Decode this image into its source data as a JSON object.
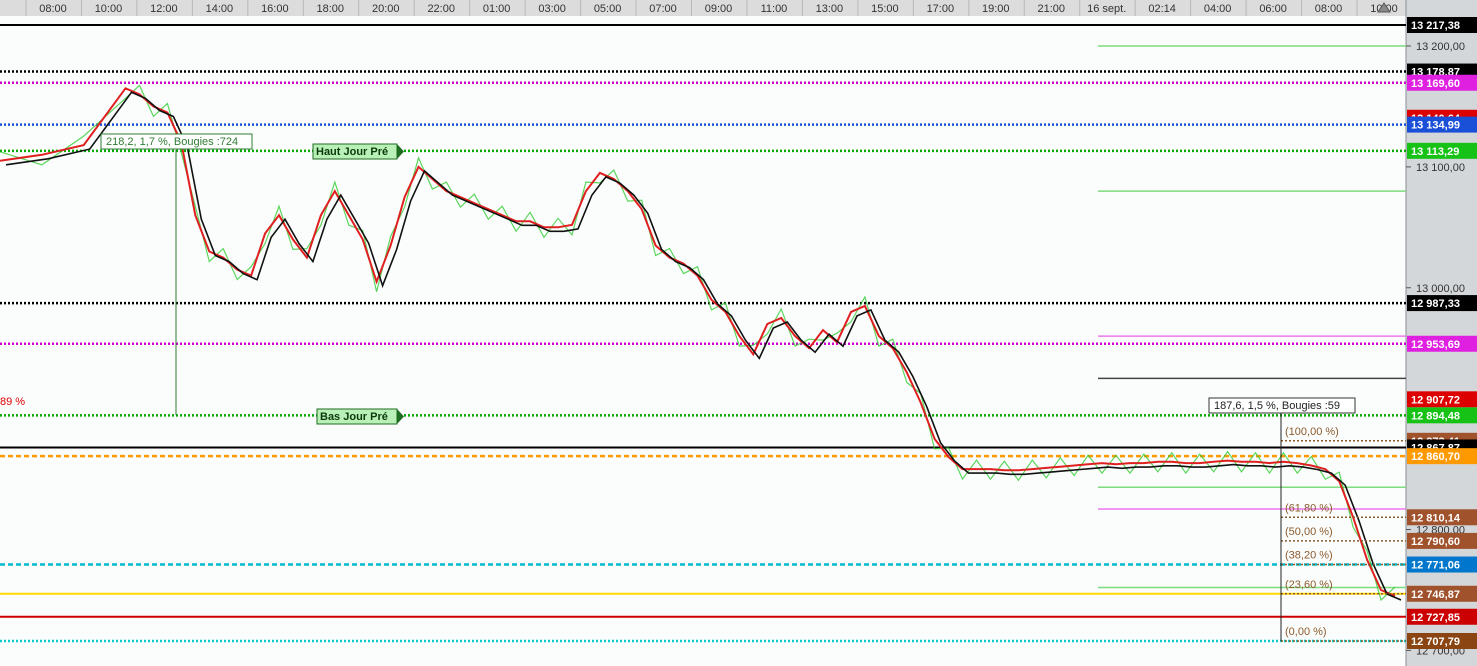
{
  "chart_data": {
    "type": "line",
    "title": "",
    "time_axis": {
      "labels": [
        "08:00",
        "10:00",
        "12:00",
        "14:00",
        "16:00",
        "18:00",
        "20:00",
        "22:00",
        "01:00",
        "03:00",
        "05:00",
        "07:00",
        "09:00",
        "11:00",
        "13:00",
        "15:00",
        "17:00",
        "19:00",
        "21:00",
        "16 sept.",
        "02:14",
        "04:00",
        "06:00",
        "08:00",
        "10:00"
      ]
    },
    "price_axis": {
      "ticks": [
        "13 200,00",
        "13 100,00",
        "13 000,00",
        "12 800,00",
        "12 700,00"
      ],
      "tick_values": [
        13200,
        13100,
        13000,
        12800,
        12700
      ],
      "range": [
        12695,
        13225
      ]
    },
    "series": [
      {
        "name": "",
        "color": "#111111",
        "x": [
          0,
          3,
          6,
          9,
          10,
          11,
          12,
          13,
          14,
          15,
          16,
          17,
          18,
          19,
          20,
          21,
          22,
          23,
          24,
          25,
          26,
          27,
          28,
          29,
          30,
          31,
          32,
          33,
          34,
          35,
          36,
          37,
          38,
          39,
          40,
          41,
          42,
          43,
          44,
          45,
          46,
          47,
          48,
          49,
          50,
          51,
          52,
          53,
          54,
          55,
          56,
          57,
          58,
          59,
          60,
          61,
          62,
          63,
          64,
          65,
          66,
          67,
          68,
          69,
          70,
          71,
          72,
          73,
          74,
          75,
          76,
          77,
          78,
          79,
          80,
          81,
          82,
          83,
          84,
          85,
          86,
          87,
          88,
          89,
          90,
          91,
          92,
          93,
          94,
          95,
          96,
          97,
          98,
          99,
          100
        ],
        "y": [
          13105,
          13110,
          13118,
          13165,
          13160,
          13150,
          13145,
          13120,
          13060,
          13030,
          13025,
          13015,
          13010,
          13045,
          13060,
          13040,
          13025,
          13060,
          13080,
          13060,
          13040,
          13005,
          13035,
          13075,
          13100,
          13090,
          13080,
          13075,
          13070,
          13065,
          13060,
          13055,
          13055,
          13050,
          13050,
          13052,
          13080,
          13095,
          13090,
          13080,
          13065,
          13035,
          13025,
          13020,
          13010,
          12990,
          12980,
          12960,
          12945,
          12970,
          12975,
          12960,
          12950,
          12965,
          12955,
          12980,
          12985,
          12960,
          12950,
          12930,
          12905,
          12875,
          12860,
          12850,
          12850,
          12850,
          12849,
          12849,
          12850,
          12851,
          12852,
          12853,
          12854,
          12855,
          12854,
          12855,
          12855,
          12856,
          12856,
          12855,
          12855,
          12856,
          12857,
          12856,
          12856,
          12855,
          12856,
          12855,
          12853,
          12850,
          12840,
          12810,
          12775,
          12750,
          12745
        ]
      }
    ],
    "levels": [
      {
        "value": 13217.38,
        "label": "13 217,38",
        "color": "#000000",
        "badge_bg": "#000000",
        "badge_fg": "#ffffff",
        "style": "solid"
      },
      {
        "value": 13178.87,
        "label": "13 178,87",
        "color": "#000000",
        "badge_bg": "#000000",
        "badge_fg": "#ffffff",
        "style": "dotted"
      },
      {
        "value": 13169.6,
        "label": "13 169,60",
        "color": "#cc00cc",
        "badge_bg": "#e020e0",
        "badge_fg": "#ffffff",
        "style": "dotted"
      },
      {
        "value": 13140.64,
        "label": "13 140,64",
        "color": "#dd0000",
        "badge_bg": "#dd0000",
        "badge_fg": "#ffffff",
        "style": "none"
      },
      {
        "value": 13134.99,
        "label": "13 134,99",
        "color": "#1a4fd8",
        "badge_bg": "#1a4fd8",
        "badge_fg": "#ffffff",
        "style": "dotted"
      },
      {
        "value": 13113.29,
        "label": "13 113,29",
        "color": "#00aa00",
        "badge_bg": "#16c216",
        "badge_fg": "#ffffff",
        "style": "dotted"
      },
      {
        "value": 12987.33,
        "label": "12 987,33",
        "color": "#000000",
        "badge_bg": "#000000",
        "badge_fg": "#ffffff",
        "style": "dotted"
      },
      {
        "value": 12953.69,
        "label": "12 953,69",
        "color": "#cc00cc",
        "badge_bg": "#e020e0",
        "badge_fg": "#ffffff",
        "style": "dotted"
      },
      {
        "value": 12907.72,
        "label": "12 907,72",
        "color": "#dd0000",
        "badge_bg": "#dd0000",
        "badge_fg": "#ffffff",
        "style": "none"
      },
      {
        "value": 12894.48,
        "label": "12 894,48",
        "color": "#00aa00",
        "badge_bg": "#16c216",
        "badge_fg": "#ffffff",
        "style": "dotted"
      },
      {
        "value": 12873.41,
        "label": "12 873,41",
        "color": "#a0522d",
        "badge_bg": "#a0522d",
        "badge_fg": "#ffffff",
        "style": "none"
      },
      {
        "value": 12867.87,
        "label": "12 867,87",
        "color": "#000000",
        "badge_bg": "#000000",
        "badge_fg": "#ffffff",
        "style": "solid"
      },
      {
        "value": 12860.7,
        "label": "12 860,70",
        "color": "#ff9900",
        "badge_bg": "#ff9900",
        "badge_fg": "#ffffff",
        "style": "dashed"
      },
      {
        "value": 12810.14,
        "label": "12 810,14",
        "color": "#a0522d",
        "badge_bg": "#a0522d",
        "badge_fg": "#ffffff",
        "style": "none"
      },
      {
        "value": 12790.6,
        "label": "12 790,60",
        "color": "#a0522d",
        "badge_bg": "#a0522d",
        "badge_fg": "#ffffff",
        "style": "none"
      },
      {
        "value": 12771.06,
        "label": "12 771,06",
        "color": "#00bbcc",
        "badge_bg": "#0077cc",
        "badge_fg": "#ffffff",
        "style": "dashed"
      },
      {
        "value": 12746.87,
        "label": "12 746,87",
        "color": "#ffd700",
        "badge_bg": "#a0522d",
        "badge_fg": "#ffffff",
        "style": "solid"
      },
      {
        "value": 12727.85,
        "label": "12 727,85",
        "color": "#cc0000",
        "badge_bg": "#cc0000",
        "badge_fg": "#ffffff",
        "style": "solid"
      },
      {
        "value": 12707.79,
        "label": "12 707,79",
        "color": "#00cccc",
        "badge_bg": "#8b4513",
        "badge_fg": "#ffffff",
        "style": "dotted"
      }
    ],
    "fibonacci": [
      {
        "label": "(100,00 %)",
        "value": 12873.41
      },
      {
        "label": "(61,80 %)",
        "value": 12810.14
      },
      {
        "label": "(50,00 %)",
        "value": 12790.6
      },
      {
        "label": "(38,20 %)",
        "value": 12771.06
      },
      {
        "label": "(23,60 %)",
        "value": 12746.87
      },
      {
        "label": "(0,00 %)",
        "value": 12707.79
      }
    ],
    "annotations": {
      "measure_1": "218,2, 1,7 %, Bougies :724",
      "measure_2": "187,6, 1,5 %, Bougies :59",
      "haut_jour": "Haut Jour Pré",
      "bas_jour": "Bas Jour Pré",
      "left_pct": "89 %"
    },
    "grid": false
  }
}
